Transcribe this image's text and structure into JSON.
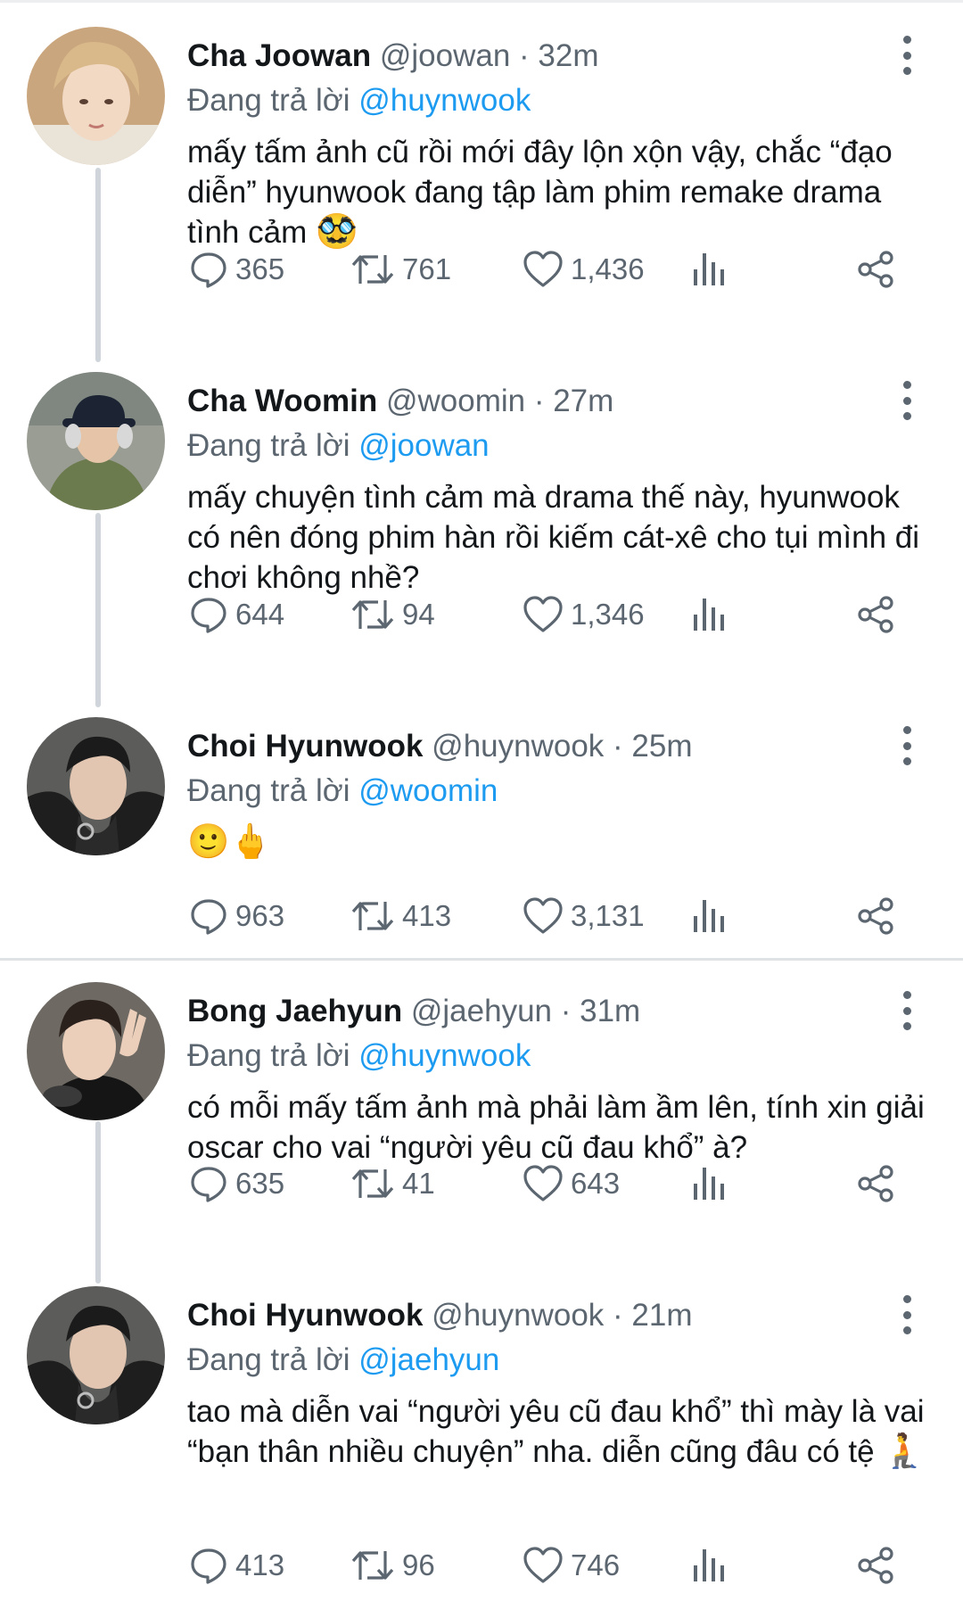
{
  "reply_prefix": "Đang trả lời",
  "colors": {
    "accent": "#1d9bf0",
    "muted": "#5b6670",
    "text": "#14171a"
  },
  "tweets": [
    {
      "name": "Cha Joowan",
      "handle": "@joowan · 32m",
      "reply_to": "@huynwook",
      "body": "mấy tấm ảnh cũ rồi mới đây lộn xộn vậy, chắc “đạo diễn” hyunwook đang tập làm phim remake drama tình cảm",
      "emoji": "🥸",
      "replies": "365",
      "retweets": "761",
      "likes": "1,436"
    },
    {
      "name": "Cha Woomin",
      "handle": "@woomin · 27m",
      "reply_to": "@joowan",
      "body": "mấy chuyện tình cảm mà drama thế này, hyunwook có nên đóng phim hàn rồi kiếm cát-xê cho tụi mình đi chơi không nhề?",
      "emoji": "",
      "replies": "644",
      "retweets": "94",
      "likes": "1,346"
    },
    {
      "name": "Choi Hyunwook",
      "handle": "@huynwook · 25m",
      "reply_to": "@woomin",
      "body": "",
      "emoji": "🙂🖕",
      "replies": "963",
      "retweets": "413",
      "likes": "3,131"
    },
    {
      "name": "Bong Jaehyun",
      "handle": "@jaehyun · 31m",
      "reply_to": "@huynwook",
      "body": "có mỗi mấy tấm ảnh mà phải làm ầm lên, tính xin giải oscar cho vai “người yêu cũ đau khổ” à?",
      "emoji": "",
      "replies": "635",
      "retweets": "41",
      "likes": "643"
    },
    {
      "name": "Choi Hyunwook",
      "handle": "@huynwook · 21m",
      "reply_to": "@jaehyun",
      "body": "tao mà diễn vai “người yêu cũ đau khổ” thì mày là vai “bạn thân nhiều chuyện” nha. diễn cũng đâu có tệ",
      "emoji": "🧎",
      "replies": "413",
      "retweets": "96",
      "likes": "746"
    }
  ]
}
